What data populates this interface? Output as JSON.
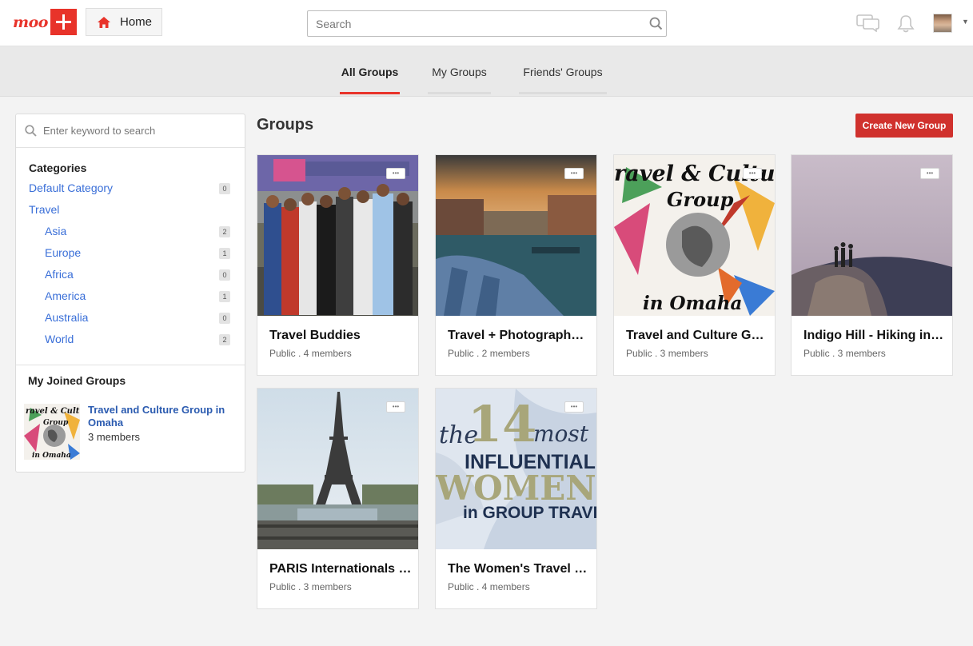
{
  "header": {
    "logo_text": "moo",
    "home_label": "Home",
    "search_placeholder": "Search",
    "icons": [
      "messages-icon",
      "bell-icon",
      "user-avatar"
    ]
  },
  "tabs": [
    {
      "label": "All Groups",
      "active": true
    },
    {
      "label": "My Groups",
      "active": false
    },
    {
      "label": "Friends' Groups",
      "active": false
    }
  ],
  "sidebar": {
    "search_placeholder": "Enter keyword to search",
    "categories_title": "Categories",
    "categories": [
      {
        "label": "Default Category",
        "count": "0",
        "level": 0
      },
      {
        "label": "Travel",
        "count": "",
        "level": 0
      },
      {
        "label": "Asia",
        "count": "2",
        "level": 1
      },
      {
        "label": "Europe",
        "count": "1",
        "level": 1
      },
      {
        "label": "Africa",
        "count": "0",
        "level": 1
      },
      {
        "label": "America",
        "count": "1",
        "level": 1
      },
      {
        "label": "Australia",
        "count": "0",
        "level": 1
      },
      {
        "label": "World",
        "count": "2",
        "level": 1
      }
    ],
    "joined_title": "My Joined Groups",
    "joined": [
      {
        "name": "Travel and Culture Group in Omaha",
        "members": "3 members"
      }
    ]
  },
  "main": {
    "title": "Groups",
    "create_label": "Create New Group",
    "more_label": "•••",
    "groups": [
      {
        "name": "Travel Buddies",
        "meta": "Public . 4 members"
      },
      {
        "name": "Travel + Photography M...",
        "meta": "Public . 2 members"
      },
      {
        "name": "Travel and Culture Grou...",
        "meta": "Public . 3 members"
      },
      {
        "name": "Indigo Hill - Hiking in K...",
        "meta": "Public . 3 members"
      },
      {
        "name": "PARIS Internationals & ...",
        "meta": "Public . 3 members"
      },
      {
        "name": "The Women's Travel Gr...",
        "meta": "Public . 4 members"
      }
    ],
    "image_texts": {
      "culture_top": "ravel & Cultu",
      "culture_mid": "Group",
      "culture_bottom": "in Omaha",
      "women_the": "the",
      "women_14": "14",
      "women_most": "most",
      "women_influential": "INFLUENTIAL",
      "women_women": "WOMEN",
      "women_travel": "in GROUP TRAVEL",
      "joined_top": "ravel & Cultu",
      "joined_mid": "Group",
      "joined_bottom": "in Omaha"
    }
  },
  "colors": {
    "brand": "#e8332a",
    "create_button": "#d0312d",
    "link": "#3a6fd8"
  }
}
